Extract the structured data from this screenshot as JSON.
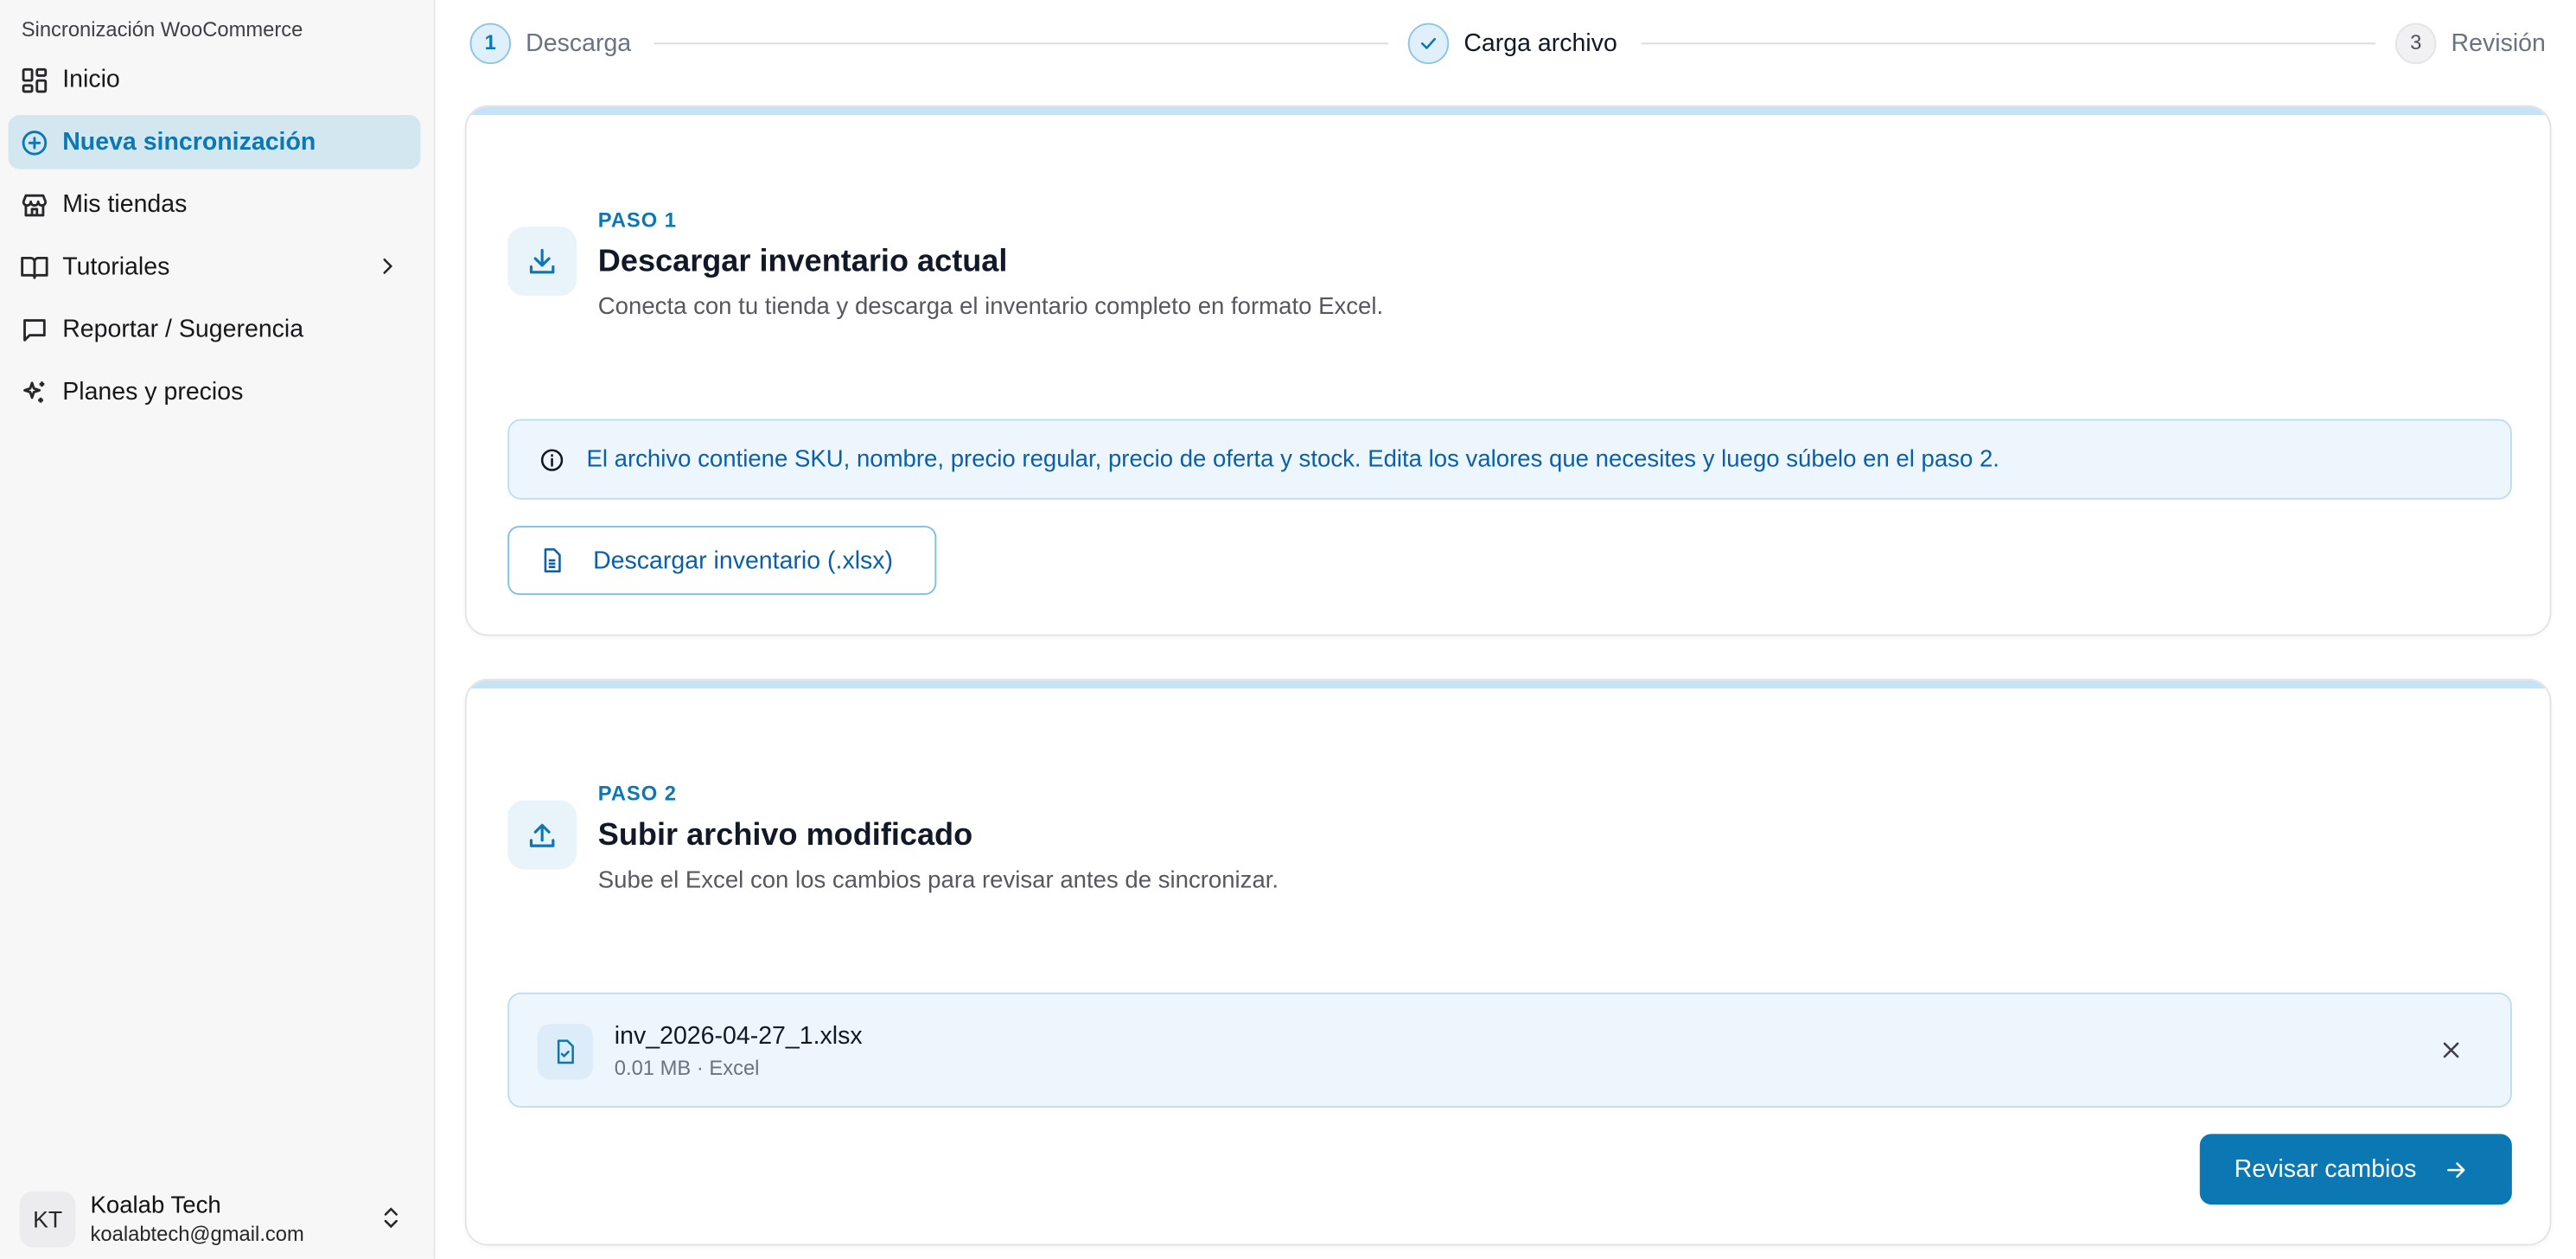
{
  "sidebar": {
    "app_title": "Sincronización WooCommerce",
    "items": [
      {
        "label": "Inicio",
        "icon": "dashboard-icon"
      },
      {
        "label": "Nueva sincronización",
        "icon": "plus-circle-icon",
        "active": true
      },
      {
        "label": "Mis tiendas",
        "icon": "store-icon"
      },
      {
        "label": "Tutoriales",
        "icon": "book-icon",
        "has_submenu": true
      },
      {
        "label": "Reportar / Sugerencia",
        "icon": "message-icon"
      },
      {
        "label": "Planes y precios",
        "icon": "sparkles-icon"
      }
    ],
    "user": {
      "initials": "KT",
      "name": "Koalab Tech",
      "email": "koalabtech@gmail.com"
    }
  },
  "stepper": {
    "steps": [
      {
        "number": "1",
        "label": "Descarga",
        "state": "current"
      },
      {
        "number": "",
        "label": "Carga archivo",
        "state": "completed"
      },
      {
        "number": "3",
        "label": "Revisión",
        "state": "pending"
      }
    ]
  },
  "step1": {
    "kicker": "PASO 1",
    "title": "Descargar inventario actual",
    "description": "Conecta con tu tienda y descarga el inventario completo en formato Excel.",
    "info": "El archivo contiene SKU, nombre, precio regular, precio de oferta y stock. Edita los valores que necesites y luego súbelo en el paso 2.",
    "download_button": "Descargar inventario (.xlsx)"
  },
  "step2": {
    "kicker": "PASO 2",
    "title": "Subir archivo modificado",
    "description": "Sube el Excel con los cambios para revisar antes de sincronizar.",
    "file": {
      "name": "inv_2026-04-27_1.xlsx",
      "meta": "0.01 MB · Excel"
    },
    "review_button": "Revisar cambios"
  },
  "colors": {
    "accent": "#0b78b4",
    "active_nav_bg": "#d3e7f1",
    "info_bg": "#eef6fd"
  }
}
